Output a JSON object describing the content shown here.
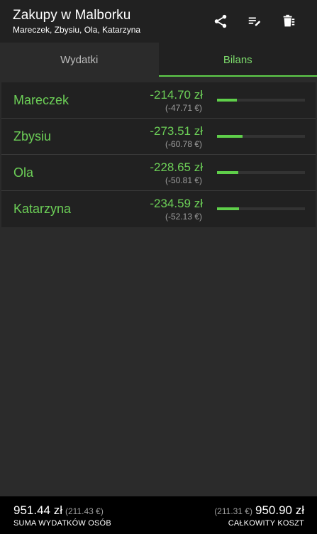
{
  "appbar": {
    "title": "Zakupy w Malborku",
    "subtitle": "Mareczek, Zbysiu, Ola, Katarzyna",
    "actions": [
      "share-icon",
      "edit-list-icon",
      "delete-icon"
    ]
  },
  "tabs": [
    {
      "label": "Wydatki",
      "active": false
    },
    {
      "label": "Bilans",
      "active": true
    }
  ],
  "balances": [
    {
      "name": "Mareczek",
      "amount": "-214.70 zł",
      "eur": "(-47.71 €)",
      "share": 0.225
    },
    {
      "name": "Zbysiu",
      "amount": "-273.51 zł",
      "eur": "(-60.78 €)",
      "share": 0.287
    },
    {
      "name": "Ola",
      "amount": "-228.65 zł",
      "eur": "(-50.81 €)",
      "share": 0.24
    },
    {
      "name": "Katarzyna",
      "amount": "-234.59 zł",
      "eur": "(-52.13 €)",
      "share": 0.246
    }
  ],
  "footer": {
    "left_amount": "951.44 zł",
    "left_eur": "(211.43 €)",
    "left_label": "SUMA WYDATKÓW OSÓB",
    "right_eur": "(211.31 €)",
    "right_amount": "950.90 zł",
    "right_label": "CAŁKOWITY KOSZT"
  },
  "colors": {
    "accent": "#5fcf4a",
    "accent_text": "#6ccf57",
    "appbar_bg": "#212121",
    "background": "#2b2b2b",
    "footer_bg": "#000000"
  }
}
